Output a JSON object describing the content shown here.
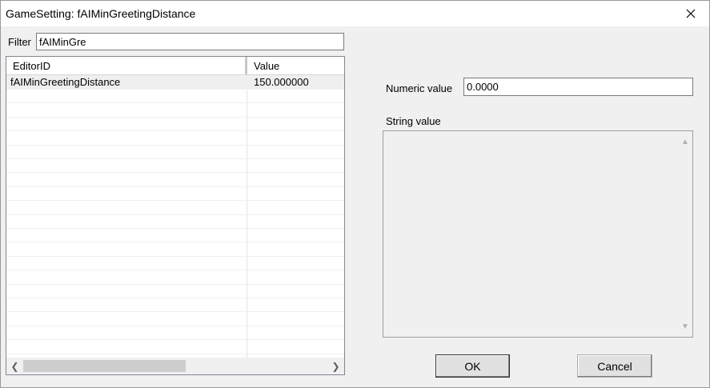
{
  "window": {
    "title": "GameSetting: fAIMinGreetingDistance",
    "close_icon": "close-icon"
  },
  "filter": {
    "label": "Filter",
    "value": "fAIMinGre"
  },
  "list": {
    "columns": [
      "EditorID",
      "Value"
    ],
    "rows": [
      {
        "editor_id": "fAIMinGreetingDistance",
        "value": "150.000000"
      }
    ],
    "scroll_left_icon": "chevron-left-icon",
    "scroll_right_icon": "chevron-right-icon"
  },
  "numeric": {
    "label": "Numeric value",
    "value": "0.0000"
  },
  "string": {
    "label": "String value",
    "value": ""
  },
  "buttons": {
    "ok": "OK",
    "cancel": "Cancel"
  }
}
